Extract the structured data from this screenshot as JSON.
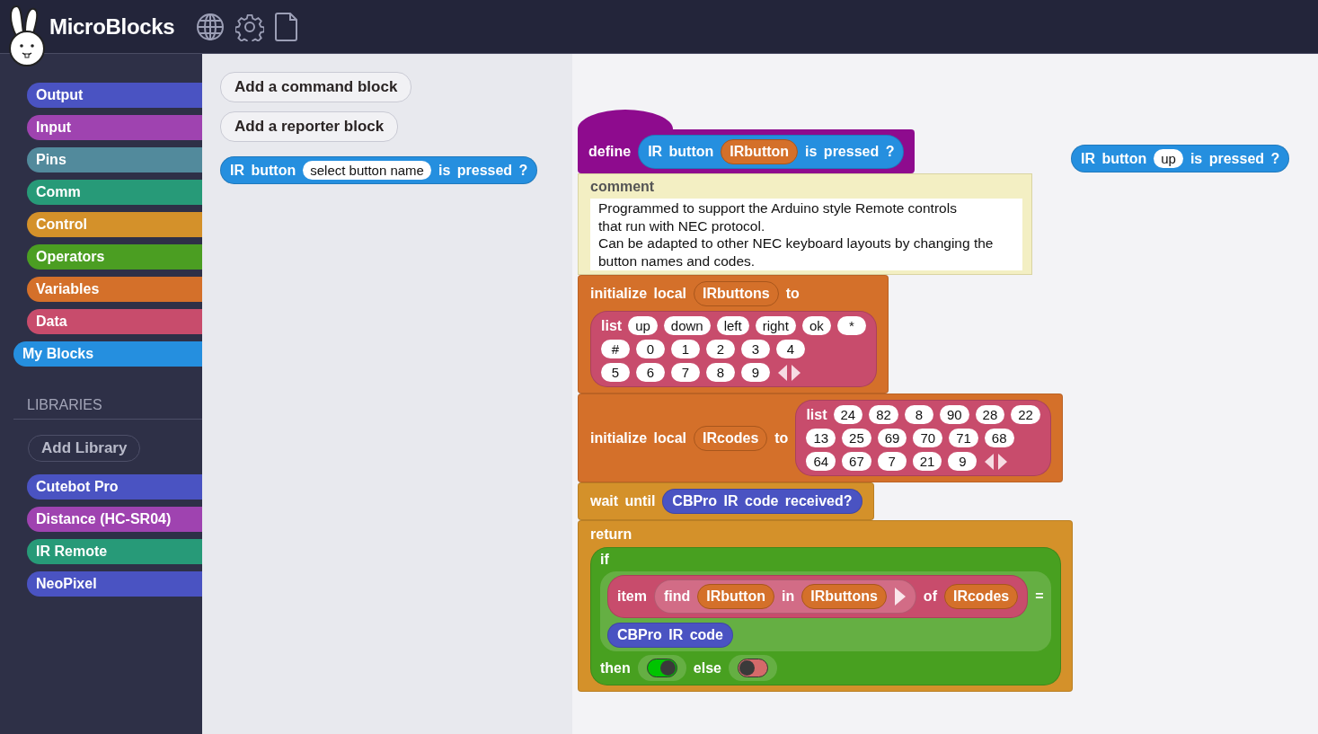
{
  "header": {
    "title": "MicroBlocks"
  },
  "categories": [
    {
      "label": "Output",
      "color": "#4a53c2",
      "selected": false
    },
    {
      "label": "Input",
      "color": "#9f43b0",
      "selected": false
    },
    {
      "label": "Pins",
      "color": "#528a9c",
      "selected": false
    },
    {
      "label": "Comm",
      "color": "#279a78",
      "selected": false
    },
    {
      "label": "Control",
      "color": "#d4912a",
      "selected": false
    },
    {
      "label": "Operators",
      "color": "#4b9e22",
      "selected": false
    },
    {
      "label": "Variables",
      "color": "#d4702a",
      "selected": false
    },
    {
      "label": "Data",
      "color": "#c84c6c",
      "selected": false
    },
    {
      "label": "My Blocks",
      "color": "#258fdf",
      "selected": true
    }
  ],
  "libraries": {
    "heading": "LIBRARIES",
    "add_button": "Add Library",
    "items": [
      {
        "label": "Cutebot Pro",
        "color": "#4a53c2"
      },
      {
        "label": "Distance (HC-SR04)",
        "color": "#9f43b0"
      },
      {
        "label": "IR Remote",
        "color": "#279a78"
      },
      {
        "label": "NeoPixel",
        "color": "#4a53c2"
      }
    ]
  },
  "palette": {
    "buttons": [
      "Add a command block",
      "Add a reporter block"
    ],
    "blocks": [
      {
        "kind": "reporter",
        "color": "#258fdf",
        "rows": [
          [
            {
              "kind": "text",
              "text": "IR button"
            },
            {
              "kind": "input",
              "text": "select button name"
            },
            {
              "kind": "text",
              "text": "is pressed ?"
            }
          ]
        ]
      }
    ]
  },
  "scripts": [
    {
      "blocks": [
        {
          "kind": "hat",
          "color": "#8e0b8e",
          "rows": [
            [
              {
                "kind": "text",
                "text": "define"
              },
              {
                "kind": "reporter",
                "color": "#258fdf",
                "rows": [
                  [
                    {
                      "kind": "text",
                      "text": "IR button"
                    },
                    {
                      "kind": "var",
                      "text": "IRbutton"
                    },
                    {
                      "kind": "text",
                      "text": "is pressed ?"
                    }
                  ]
                ]
              }
            ]
          ]
        },
        {
          "kind": "comment",
          "title": "comment",
          "text": "Programmed to support the Arduino style Remote controls\nthat run with NEC protocol.\nCan be adapted to other NEC keyboard layouts by changing the\nbutton names and codes."
        },
        {
          "kind": "command",
          "color": "#d4702a",
          "rows": [
            [
              {
                "kind": "text",
                "text": "initialize local"
              },
              {
                "kind": "var",
                "text": "IRbuttons"
              },
              {
                "kind": "text",
                "text": "to"
              }
            ],
            [
              {
                "kind": "list",
                "color": "#c84c6c",
                "label": "list",
                "items": [
                  "up",
                  "down",
                  "left",
                  "right",
                  "ok",
                  "*",
                  "#",
                  "0",
                  "1",
                  "2",
                  "3",
                  "4",
                  "5",
                  "6",
                  "7",
                  "8",
                  "9"
                ]
              }
            ]
          ]
        },
        {
          "kind": "command",
          "color": "#d4702a",
          "rows": [
            [
              {
                "kind": "text",
                "text": "initialize local"
              },
              {
                "kind": "var",
                "text": "IRcodes"
              },
              {
                "kind": "text",
                "text": "to"
              },
              {
                "kind": "list",
                "color": "#c84c6c",
                "label": "list",
                "items": [
                  "24",
                  "82",
                  "8",
                  "90",
                  "28",
                  "22",
                  "13",
                  "25",
                  "69",
                  "70",
                  "71",
                  "68",
                  "64",
                  "67",
                  "7",
                  "21",
                  "9"
                ]
              }
            ]
          ]
        },
        {
          "kind": "command",
          "color": "#d4912a",
          "rows": [
            [
              {
                "kind": "text",
                "text": "wait until"
              },
              {
                "kind": "reporter",
                "color": "#4a53c2",
                "rows": [
                  [
                    {
                      "kind": "text",
                      "text": "CBPro IR code received?"
                    }
                  ]
                ]
              }
            ]
          ]
        },
        {
          "kind": "command",
          "color": "#d4912a",
          "rows": [
            [
              {
                "kind": "text",
                "text": "return"
              }
            ],
            [
              {
                "kind": "reporter",
                "color": "#48a020",
                "rows": [
                  [
                    {
                      "kind": "text",
                      "text": "if"
                    }
                  ],
                  [
                    {
                      "kind": "panel",
                      "rows": [
                        [
                          {
                            "kind": "reporter",
                            "color": "#c84c6c",
                            "rows": [
                              [
                                {
                                  "kind": "text",
                                  "text": "item"
                                },
                                {
                                  "kind": "reporter",
                                  "color": "#d26c86",
                                  "rows": [
                                    [
                                      {
                                        "kind": "text",
                                        "text": "find"
                                      },
                                      {
                                        "kind": "var",
                                        "text": "IRbutton"
                                      },
                                      {
                                        "kind": "text",
                                        "text": "in"
                                      },
                                      {
                                        "kind": "var",
                                        "text": "IRbuttons"
                                      },
                                      {
                                        "kind": "arrow"
                                      }
                                    ]
                                  ]
                                },
                                {
                                  "kind": "text",
                                  "text": "of"
                                },
                                {
                                  "kind": "var",
                                  "text": "IRcodes"
                                }
                              ]
                            ]
                          },
                          {
                            "kind": "text",
                            "text": "="
                          }
                        ],
                        [
                          {
                            "kind": "reporter",
                            "color": "#4a53c2",
                            "rows": [
                              [
                                {
                                  "kind": "text",
                                  "text": "CBPro IR code"
                                }
                              ]
                            ]
                          }
                        ]
                      ]
                    }
                  ],
                  [
                    {
                      "kind": "text",
                      "text": "then"
                    },
                    {
                      "kind": "toggle",
                      "on": true
                    },
                    {
                      "kind": "text",
                      "text": "else"
                    },
                    {
                      "kind": "toggle",
                      "on": false
                    }
                  ]
                ]
              }
            ]
          ]
        }
      ]
    },
    {
      "blocks": [
        {
          "kind": "reporter",
          "color": "#258fdf",
          "rows": [
            [
              {
                "kind": "text",
                "text": "IR button"
              },
              {
                "kind": "input",
                "text": "up"
              },
              {
                "kind": "text",
                "text": "is pressed ?"
              }
            ]
          ]
        }
      ]
    }
  ]
}
